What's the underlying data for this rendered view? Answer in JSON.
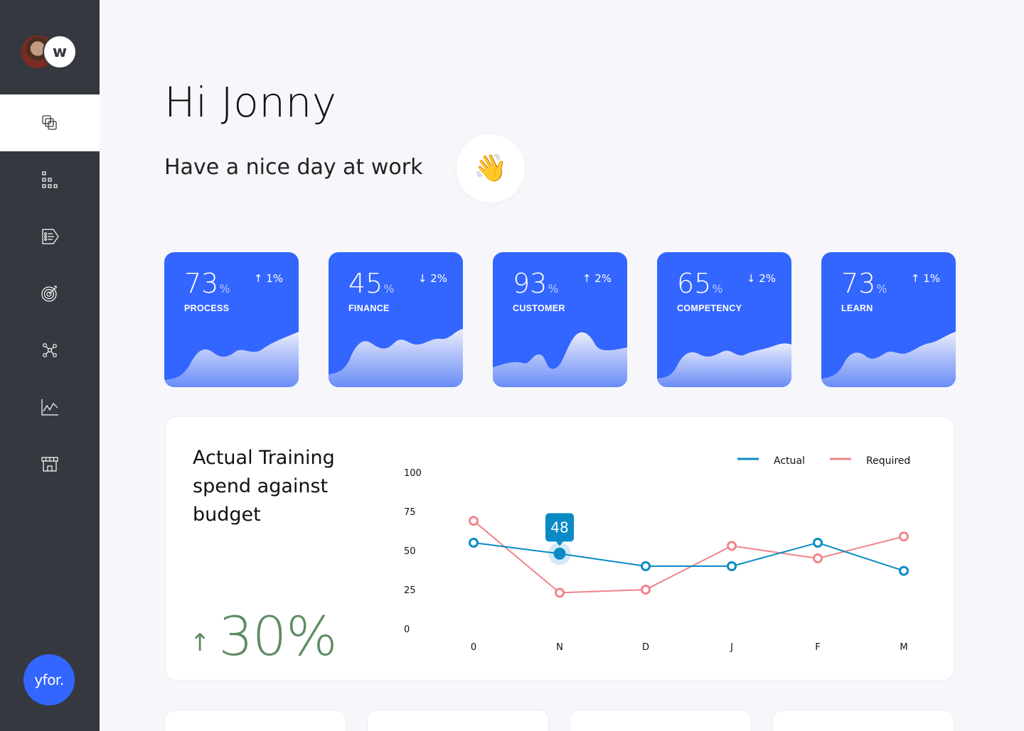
{
  "greeting": "Hi Jonny",
  "subtitle": "Have a nice day at work",
  "wave_emoji": "👋",
  "sidebar": {
    "org_logo_text": "w",
    "brand_text": "yfor.",
    "items": [
      {
        "icon": "layers-icon",
        "active": true
      },
      {
        "icon": "org-chart-icon",
        "active": false
      },
      {
        "icon": "list-tag-icon",
        "active": false
      },
      {
        "icon": "target-icon",
        "active": false
      },
      {
        "icon": "network-icon",
        "active": false
      },
      {
        "icon": "line-chart-icon",
        "active": false
      },
      {
        "icon": "store-icon",
        "active": false
      }
    ]
  },
  "kpis": [
    {
      "value": "73",
      "unit": "%",
      "change": "↑ 1%",
      "label": "PROCESS"
    },
    {
      "value": "45",
      "unit": "%",
      "change": "↓ 2%",
      "label": "FINANCE"
    },
    {
      "value": "93",
      "unit": "%",
      "change": "↑ 2%",
      "label": "CUSTOMER"
    },
    {
      "value": "65",
      "unit": "%",
      "change": "↓ 2%",
      "label": "COMPETENCY"
    },
    {
      "value": "73",
      "unit": "%",
      "change": "↑ 1%",
      "label": "LEARN"
    }
  ],
  "colors": {
    "kpi_bg": "#3366ff",
    "actual": "#0a8bc6",
    "required": "#f1848a",
    "trend": "#5e8c63",
    "sidebar_bg": "#363840"
  },
  "panel": {
    "title": "Actual Training spend against budget",
    "trend_arrow": "↑",
    "trend_value": "30%"
  },
  "chart_data": {
    "type": "line",
    "categories": [
      "0",
      "N",
      "D",
      "J",
      "F",
      "M"
    ],
    "yticks": [
      "100",
      "75",
      "50",
      "25",
      "0"
    ],
    "ylim": [
      0,
      100
    ],
    "series": [
      {
        "name": "Actual",
        "color": "#0a8bc6",
        "values": [
          55,
          48,
          40,
          40,
          55,
          37
        ]
      },
      {
        "name": "Required",
        "color": "#f1848a",
        "values": [
          69,
          23,
          25,
          53,
          45,
          59
        ]
      }
    ],
    "highlight": {
      "series": "Actual",
      "index": 1,
      "label": "48"
    },
    "legend": "top-right"
  }
}
